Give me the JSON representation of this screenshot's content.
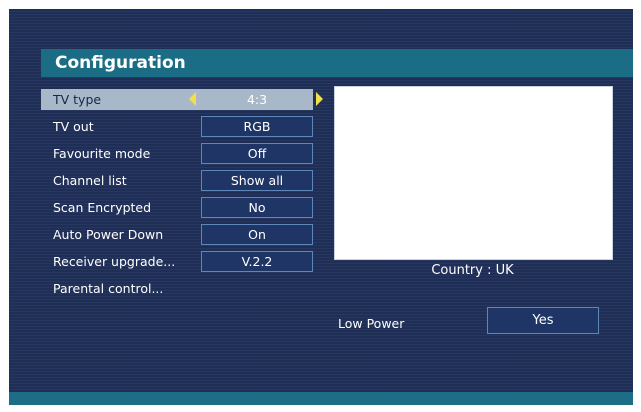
{
  "header": {
    "title": "Configuration"
  },
  "settings": [
    {
      "label": "TV type",
      "value": "4:3",
      "selected": true
    },
    {
      "label": "TV out",
      "value": "RGB"
    },
    {
      "label": "Favourite mode",
      "value": "Off"
    },
    {
      "label": "Channel list",
      "value": "Show all"
    },
    {
      "label": "Scan Encrypted",
      "value": "No"
    },
    {
      "label": "Auto Power Down",
      "value": "On"
    },
    {
      "label": "Receiver upgrade...",
      "value": "V.2.2"
    },
    {
      "label": "Parental control..."
    }
  ],
  "preview": {
    "country": "Country : UK"
  },
  "low_power": {
    "label": "Low Power",
    "value": "Yes"
  },
  "icons": {
    "left": "arrow-left-icon",
    "right": "arrow-right-icon"
  },
  "colors": {
    "title_bar": "#1b6d86",
    "background": "#20305a",
    "highlight": "#a9b8c9",
    "arrow": "#f0e04a"
  }
}
